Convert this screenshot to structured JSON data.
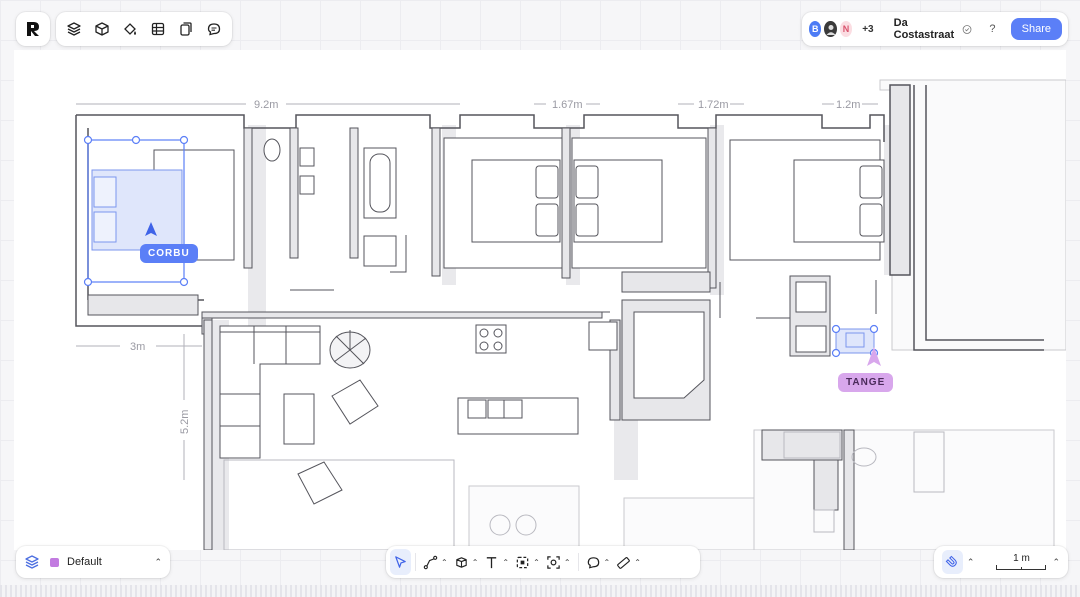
{
  "app": {
    "logo_icon": "logo-r-icon"
  },
  "top_toolbar": {
    "items": [
      {
        "name": "layers-icon"
      },
      {
        "name": "cube-icon"
      },
      {
        "name": "paint-bucket-icon"
      },
      {
        "name": "table-icon"
      },
      {
        "name": "pages-icon"
      },
      {
        "name": "comment-icon"
      }
    ]
  },
  "collaborators": {
    "avatars": [
      {
        "initial": "B"
      },
      {
        "initial": ""
      },
      {
        "initial": "N"
      }
    ],
    "extra_count": "+3"
  },
  "project": {
    "name": "Da Costastraat",
    "help_label": "?",
    "share_label": "Share"
  },
  "layer": {
    "name": "Default",
    "color": "#c27be0"
  },
  "cursors": {
    "corbu": {
      "label": "CORBU",
      "color": "#5b7ff7"
    },
    "tange": {
      "label": "TANGE",
      "color": "#d8a7ec"
    }
  },
  "dimensions": {
    "d1": "9.2m",
    "d2": "1.67m",
    "d3": "1.72m",
    "d4": "1.2m",
    "d5": "3m",
    "d6": "5.2m"
  },
  "scale": {
    "label": "1 m"
  },
  "colors": {
    "accent": "#5b7ff7",
    "wall": "#55555c",
    "wall_fill": "#e7e7ea"
  }
}
